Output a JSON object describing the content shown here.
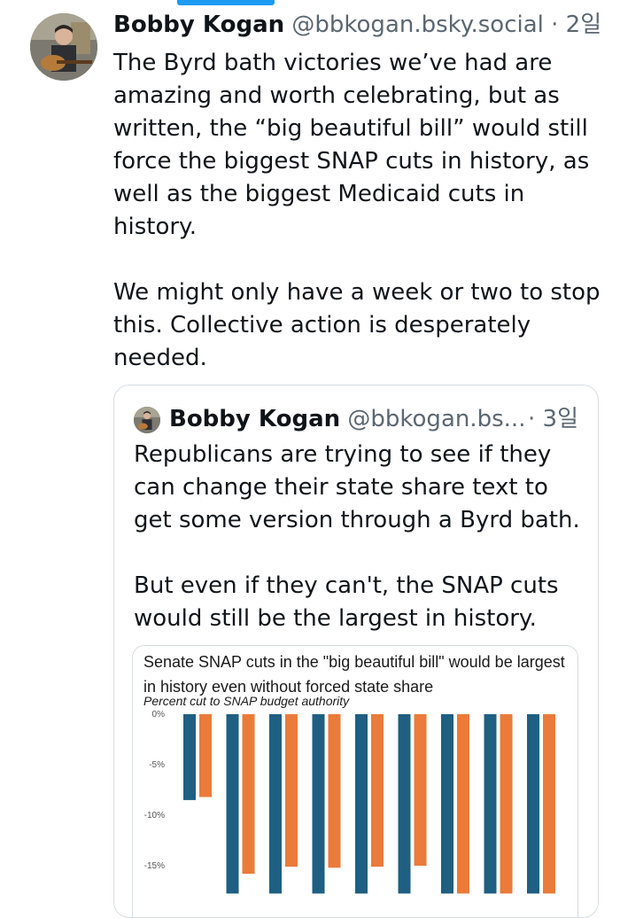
{
  "post": {
    "author": "Bobby Kogan",
    "handle": "@bbkogan.bsky.social",
    "separator": "·",
    "time": "2일",
    "paragraphs": [
      "The Byrd bath victories we’ve had are amazing and worth celebrating, but as written, the “big beautiful bill” would still force the biggest SNAP cuts in history, as well as the biggest Medicaid cuts in history.",
      "We might only have a week or two to stop this. Collective action is desperately needed."
    ]
  },
  "quote": {
    "author": "Bobby Kogan",
    "handle": "@bbkogan.bs...",
    "time": "· 3일",
    "paragraphs": [
      "Republicans are trying to see if they can change their state share text to get some version through a Byrd bath.",
      "But even if they can't, the SNAP cuts would still be the largest in history."
    ]
  },
  "chart_data": {
    "type": "bar",
    "title": "Senate SNAP cuts in the \"big beautiful bill\" would be largest in history even without forced state share",
    "subtitle": "Percent cut to SNAP budget authority",
    "ytick_labels": [
      "0%",
      "-5%",
      "-10%",
      "-15%"
    ],
    "ylim": [
      -16,
      0
    ],
    "grid": false,
    "colors": [
      "#1f5f82",
      "#ea7b3a"
    ],
    "pairs": [
      [
        -8.5,
        -8.2
      ],
      [
        -16,
        -15.8
      ],
      [
        -16,
        -15.1
      ],
      [
        -16,
        -15.2
      ],
      [
        -16,
        -15.1
      ],
      [
        -16,
        -15.0
      ],
      [
        -16,
        -16
      ],
      [
        -16,
        -16
      ],
      [
        -16,
        -16
      ]
    ]
  }
}
